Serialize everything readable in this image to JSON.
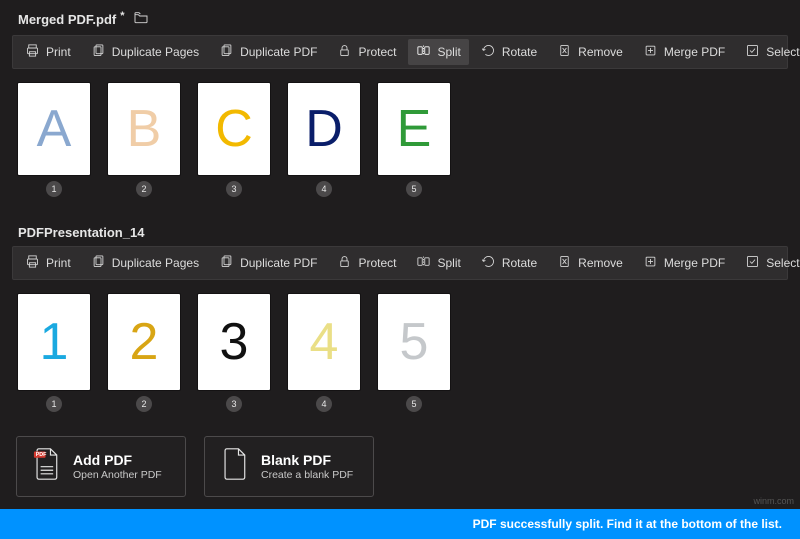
{
  "docs": [
    {
      "title": "Merged PDF.pdf",
      "dirty": true,
      "show_folder": true,
      "toolbar_active": "split",
      "pages": [
        {
          "glyph": "A",
          "color": "#8aa8cf",
          "num": "1"
        },
        {
          "glyph": "B",
          "color": "#f0cda7",
          "num": "2"
        },
        {
          "glyph": "C",
          "color": "#f2b900",
          "num": "3"
        },
        {
          "glyph": "D",
          "color": "#0a1e6a",
          "num": "4"
        },
        {
          "glyph": "E",
          "color": "#2f9a38",
          "num": "5"
        }
      ]
    },
    {
      "title": "PDFPresentation_14",
      "dirty": false,
      "show_folder": false,
      "toolbar_active": null,
      "pages": [
        {
          "glyph": "1",
          "color": "#1aa9e0",
          "num": "1"
        },
        {
          "glyph": "2",
          "color": "#d8a514",
          "num": "2"
        },
        {
          "glyph": "3",
          "color": "#111111",
          "num": "3"
        },
        {
          "glyph": "4",
          "color": "#eadf86",
          "num": "4"
        },
        {
          "glyph": "5",
          "color": "#c5c8cb",
          "num": "5"
        }
      ]
    }
  ],
  "toolbar": [
    {
      "id": "print",
      "label": "Print"
    },
    {
      "id": "dup_pages",
      "label": "Duplicate Pages"
    },
    {
      "id": "dup_pdf",
      "label": "Duplicate PDF"
    },
    {
      "id": "protect",
      "label": "Protect"
    },
    {
      "id": "split",
      "label": "Split"
    },
    {
      "id": "rotate",
      "label": "Rotate"
    },
    {
      "id": "remove",
      "label": "Remove"
    },
    {
      "id": "merge",
      "label": "Merge PDF"
    },
    {
      "id": "select_all",
      "label": "Select All"
    }
  ],
  "bottom": {
    "add_pdf": {
      "title": "Add PDF",
      "sub": "Open Another PDF"
    },
    "blank_pdf": {
      "title": "Blank PDF",
      "sub": "Create a blank PDF"
    }
  },
  "status_message": "PDF successfully split. Find it at the bottom of the list.",
  "watermark": "winm.com"
}
